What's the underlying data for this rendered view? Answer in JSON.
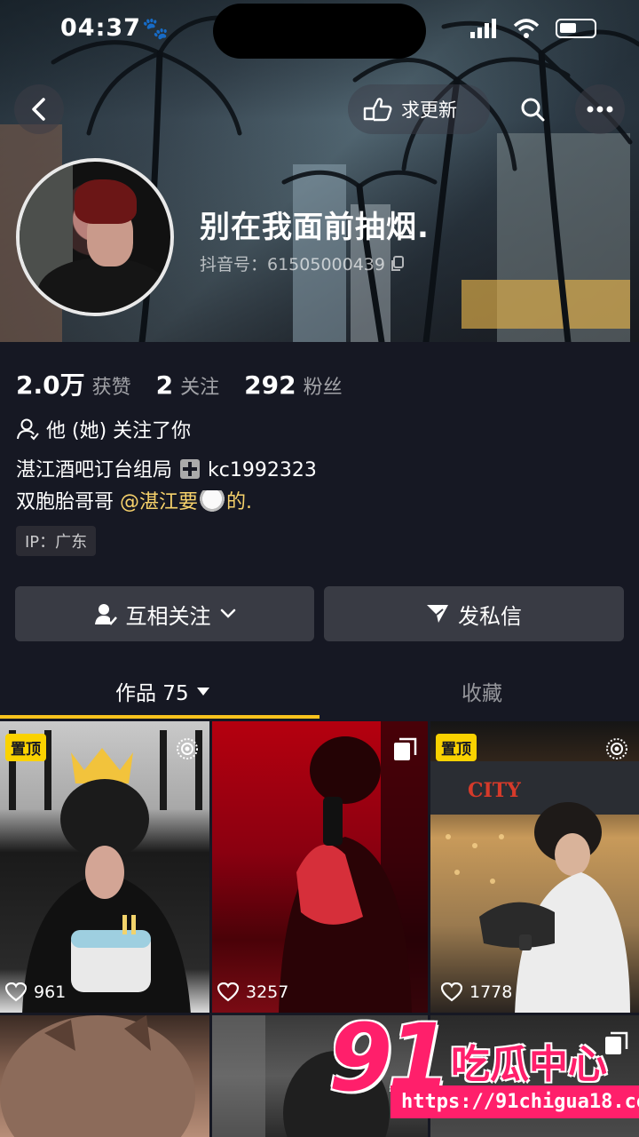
{
  "status_bar": {
    "time": "04:37"
  },
  "header": {
    "request_update_label": "求更新",
    "username": "别在我面前抽烟.",
    "douyin_id": "抖音号：61505000439"
  },
  "stats": [
    {
      "value": "2.0万",
      "label": "获赞"
    },
    {
      "value": "2",
      "label": "关注"
    },
    {
      "value": "292",
      "label": "粉丝"
    }
  ],
  "follows_you": "他 (她) 关注了你",
  "bio": {
    "line1_text": "湛江酒吧订台组局",
    "line1_contact": "kc1992323",
    "line2_text": "双胞胎哥哥",
    "line2_mention": "@湛江要",
    "line2_suffix": "的."
  },
  "ip_tag": "IP：广东",
  "actions": {
    "mutual_follow": "互相关注",
    "message": "发私信"
  },
  "tabs": {
    "works": "作品 75",
    "favorites": "收藏"
  },
  "grid": {
    "pin_label": "置顶",
    "items": [
      {
        "likes": "961"
      },
      {
        "likes": "3257"
      },
      {
        "likes": "1778"
      }
    ]
  },
  "watermark": {
    "logo_num": "91",
    "logo_text": "吃瓜中心",
    "url": "https://91chigua18.com"
  },
  "colors": {
    "background": "#161823",
    "accent": "#fac31d",
    "mention": "#f7d26b",
    "pin_badge": "#fad200",
    "button_bg": "#393b44",
    "watermark": "#ff1f6b"
  }
}
